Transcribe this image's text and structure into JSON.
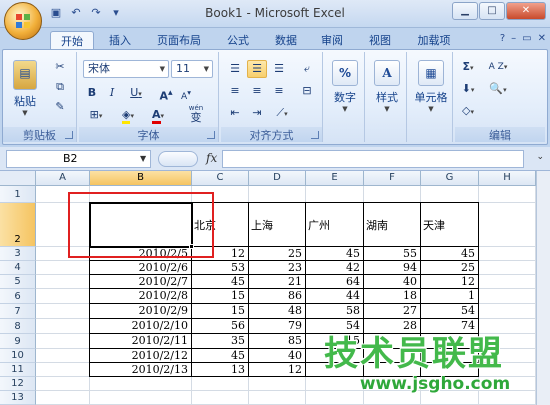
{
  "window": {
    "title": "Book1 - Microsoft Excel"
  },
  "tabs": [
    "开始",
    "插入",
    "页面布局",
    "公式",
    "数据",
    "审阅",
    "视图",
    "加载项"
  ],
  "ribbon": {
    "groups": {
      "clipboard": "剪贴板",
      "font": "字体",
      "alignment": "对齐方式",
      "number": "数字",
      "styles": "样式",
      "cells": "单元格",
      "editing": "编辑"
    },
    "paste_label": "粘贴",
    "font_name": "宋体",
    "font_size": "11",
    "number_label": "数字",
    "styles_label": "样式",
    "cells_label": "单元格",
    "percent_symbol": "%",
    "bold": "B",
    "italic": "I",
    "underline": "U",
    "grow_font": "A",
    "shrink_font": "A",
    "font_color": "A",
    "phonetic": "变",
    "phonetic_top": "wén",
    "sum_symbol": "Σ",
    "sort_label": "A Z"
  },
  "formula_bar": {
    "name_box": "B2",
    "fx": "fx",
    "formula": ""
  },
  "sheet": {
    "columns": [
      "A",
      "B",
      "C",
      "D",
      "E",
      "F",
      "G",
      "H"
    ],
    "rows": [
      "1",
      "2",
      "3",
      "4",
      "5",
      "6",
      "7",
      "8",
      "9",
      "10",
      "11",
      "12",
      "13"
    ],
    "selected_cell": "B2",
    "header_row": [
      "北京",
      "上海",
      "广州",
      "湖南",
      "天津"
    ],
    "data": [
      {
        "date": "2010/2/5",
        "values": [
          "12",
          "25",
          "45",
          "55",
          "45"
        ]
      },
      {
        "date": "2010/2/6",
        "values": [
          "53",
          "23",
          "42",
          "94",
          "25"
        ]
      },
      {
        "date": "2010/2/7",
        "values": [
          "45",
          "21",
          "64",
          "40",
          "12"
        ]
      },
      {
        "date": "2010/2/8",
        "values": [
          "15",
          "86",
          "44",
          "18",
          "1"
        ]
      },
      {
        "date": "2010/2/9",
        "values": [
          "15",
          "48",
          "58",
          "27",
          "54"
        ]
      },
      {
        "date": "2010/2/10",
        "values": [
          "56",
          "79",
          "54",
          "28",
          "74"
        ]
      },
      {
        "date": "2010/2/11",
        "values": [
          "35",
          "85",
          "15",
          "",
          ""
        ]
      },
      {
        "date": "2010/2/12",
        "values": [
          "45",
          "40",
          "",
          "",
          ""
        ]
      },
      {
        "date": "2010/2/13",
        "values": [
          "13",
          "12",
          "",
          "",
          ""
        ]
      }
    ]
  },
  "watermark": {
    "brand": "技术员联盟",
    "url": "www.jsgho.com"
  },
  "colors": {
    "ribbon_bg": "#dfe9f7",
    "selection": "#000000",
    "highlight_box": "#e02020",
    "watermark": "#43b94b"
  }
}
